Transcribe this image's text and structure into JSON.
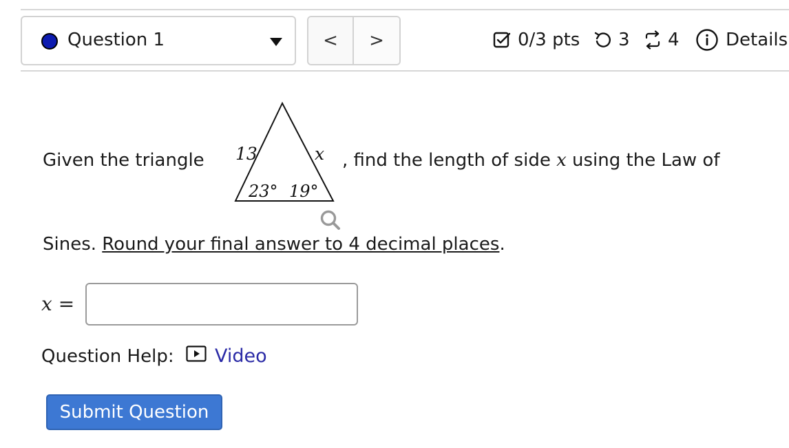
{
  "header": {
    "question_label": "Question 1",
    "status_color": "#0d1bb0",
    "nav": {
      "prev_label": "<",
      "next_label": ">"
    },
    "points": {
      "icon": "checkbox-icon",
      "text": "0/3 pts"
    },
    "tries": {
      "icon": "retry-icon",
      "text": "3"
    },
    "versions": {
      "icon": "versions-icon",
      "text": "4"
    },
    "details": {
      "icon": "info-icon",
      "text": "Details"
    }
  },
  "question": {
    "prompt_start": "Given the triangle",
    "prompt_comma": ",",
    "prompt_mid": "find the length of side",
    "prompt_var": "x",
    "prompt_end": "using the Law of",
    "line2_start": "Sines.",
    "line2_underlined": "Round your final answer to 4 decimal places",
    "line2_end": ".",
    "figure": {
      "side_left": "13",
      "side_right": "x",
      "angle_left": "23°",
      "angle_right": "19°",
      "zoom_icon": "magnifier-icon"
    }
  },
  "answer": {
    "lhs_var": "x",
    "lhs_eq": "=",
    "value": "",
    "placeholder": ""
  },
  "help": {
    "label": "Question Help:",
    "video_icon": "play-icon",
    "video_label": "Video",
    "link_color": "#2a2aa6"
  },
  "submit": {
    "label": "Submit Question",
    "color": "#3d78d3"
  }
}
